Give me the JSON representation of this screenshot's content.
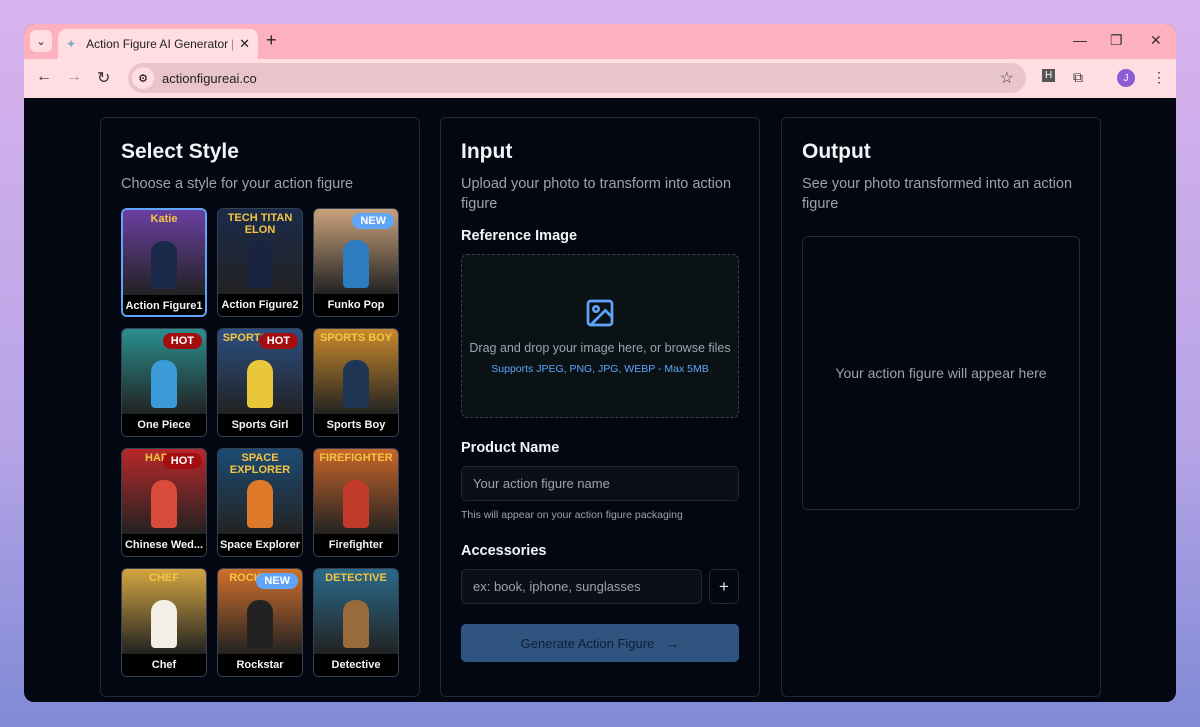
{
  "browser": {
    "tab_title": "Action Figure AI Generator | Tur",
    "url": "actionfigureai.co",
    "avatar": "J",
    "ext_label": "H"
  },
  "style": {
    "title": "Select Style",
    "subtitle": "Choose a style for your action figure",
    "items": [
      {
        "label": "Action Figure1",
        "art": "Katie",
        "bg": "#6b3fa0",
        "fig": "#1b2a4a",
        "selected": true,
        "badge": ""
      },
      {
        "label": "Action Figure2",
        "art": "TECH TITAN ELON",
        "bg": "#1b2b4b",
        "fig": "#1a2340",
        "badge": ""
      },
      {
        "label": "Funko Pop",
        "art": "",
        "bg": "#c9a27c",
        "fig": "#2e7cc0",
        "badge": "NEW"
      },
      {
        "label": "One Piece",
        "art": "",
        "bg": "#2a8f8f",
        "fig": "#3b9ad8",
        "badge": "HOT"
      },
      {
        "label": "Sports Girl",
        "art": "SPORTS GIRL",
        "bg": "#2b4f82",
        "fig": "#e8c73a",
        "badge": "HOT"
      },
      {
        "label": "Sports Boy",
        "art": "SPORTS BOY",
        "bg": "#c98a2e",
        "fig": "#1f3554",
        "badge": ""
      },
      {
        "label": "Chinese Wed...",
        "art": "HAPPY",
        "bg": "#b8282a",
        "fig": "#d94b3b",
        "badge": "HOT"
      },
      {
        "label": "Space Explorer",
        "art": "SPACE EXPLORER",
        "bg": "#1d4b73",
        "fig": "#e07a2b",
        "badge": ""
      },
      {
        "label": "Firefighter",
        "art": "FIREFIGHTER",
        "bg": "#c9662a",
        "fig": "#c23a2a",
        "badge": ""
      },
      {
        "label": "Chef",
        "art": "CHEF",
        "bg": "#d4a642",
        "fig": "#f4efe4",
        "badge": ""
      },
      {
        "label": "Rockstar",
        "art": "ROCKSTAR",
        "bg": "#d0702c",
        "fig": "#222",
        "badge": "NEW"
      },
      {
        "label": "Detective",
        "art": "DETECTIVE",
        "bg": "#2a6a8a",
        "fig": "#9a6b3a",
        "badge": ""
      }
    ]
  },
  "input": {
    "title": "Input",
    "subtitle": "Upload your photo to transform into action figure",
    "ref_label": "Reference Image",
    "drop_text": "Drag and drop your image here, or browse files",
    "drop_support": "Supports JPEG, PNG, JPG, WEBP - Max 5MB",
    "name_label": "Product Name",
    "name_placeholder": "Your action figure name",
    "name_hint": "This will appear on your action figure packaging",
    "acc_label": "Accessories",
    "acc_placeholder": "ex: book, iphone, sunglasses",
    "add": "+",
    "generate": "Generate Action Figure",
    "arrow": "→"
  },
  "output": {
    "title": "Output",
    "subtitle": "See your photo transformed into an action figure",
    "placeholder": "Your action figure will appear here"
  }
}
